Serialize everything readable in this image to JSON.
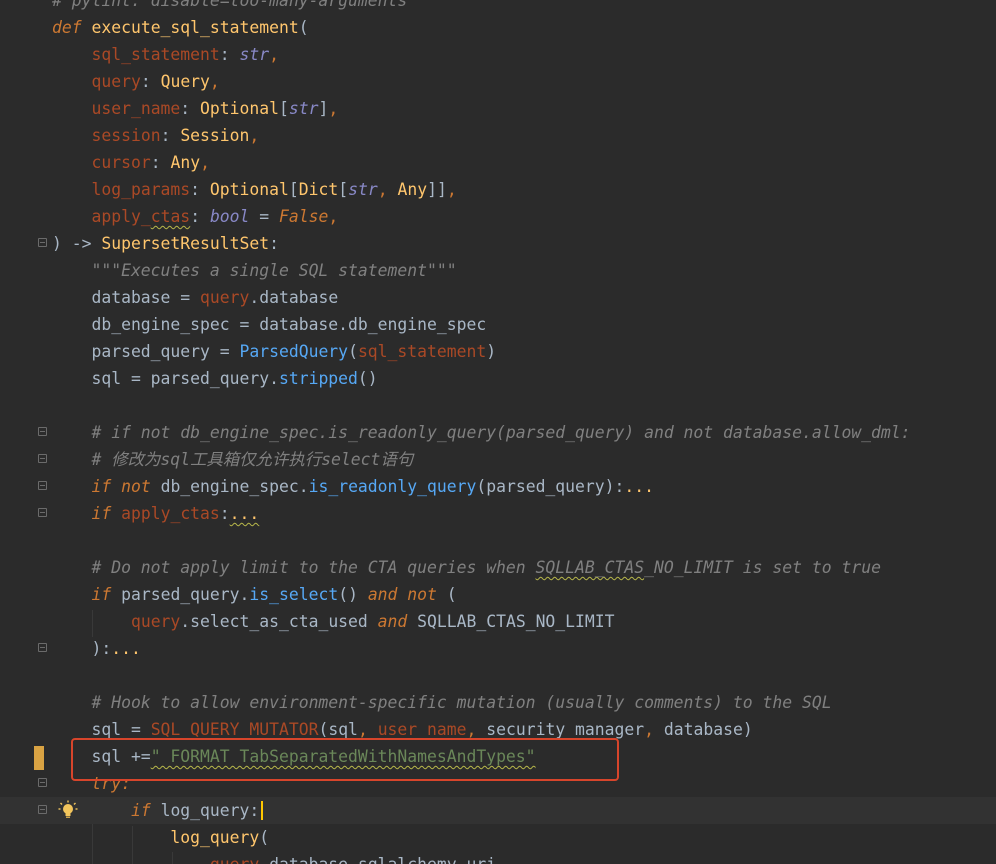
{
  "editor": {
    "language": "python",
    "highlight_color": "#d7452b",
    "lines": [
      {
        "text": "# pylint: disable=too-many-arguments"
      },
      {
        "text": "def execute_sql_statement("
      },
      {
        "text": "    sql_statement: str,"
      },
      {
        "text": "    query: Query,"
      },
      {
        "text": "    user_name: Optional[str],"
      },
      {
        "text": "    session: Session,"
      },
      {
        "text": "    cursor: Any,"
      },
      {
        "text": "    log_params: Optional[Dict[str, Any]],"
      },
      {
        "text": "    apply_ctas: bool = False,"
      },
      {
        "text": ") -> SupersetResultSet:"
      },
      {
        "text": "    \"\"\"Executes a single SQL statement\"\"\""
      },
      {
        "text": "    database = query.database"
      },
      {
        "text": "    db_engine_spec = database.db_engine_spec"
      },
      {
        "text": "    parsed_query = ParsedQuery(sql_statement)"
      },
      {
        "text": "    sql = parsed_query.stripped()"
      },
      {
        "text": ""
      },
      {
        "text": "    # if not db_engine_spec.is_readonly_query(parsed_query) and not database.allow_dml:"
      },
      {
        "text": "    # 修改为sql工具箱仅允许执行select语句"
      },
      {
        "text": "    if not db_engine_spec.is_readonly_query(parsed_query):..."
      },
      {
        "text": "    if apply_ctas:..."
      },
      {
        "text": ""
      },
      {
        "text": "    # Do not apply limit to the CTA queries when SQLLAB_CTAS_NO_LIMIT is set to true"
      },
      {
        "text": "    if parsed_query.is_select() and not ("
      },
      {
        "text": "        query.select_as_cta_used and SQLLAB_CTAS_NO_LIMIT"
      },
      {
        "text": "    ):..."
      },
      {
        "text": ""
      },
      {
        "text": "    # Hook to allow environment-specific mutation (usually comments) to the SQL"
      },
      {
        "text": "    sql = SQL_QUERY_MUTATOR(sql, user_name, security_manager, database)"
      },
      {
        "text": "    sql +=\" FORMAT TabSeparatedWithNamesAndTypes\""
      },
      {
        "text": "    try:"
      },
      {
        "text": "        if log_query:"
      },
      {
        "text": "            log_query("
      },
      {
        "text": "                query.database.sqlalchemy_uri,"
      }
    ]
  }
}
